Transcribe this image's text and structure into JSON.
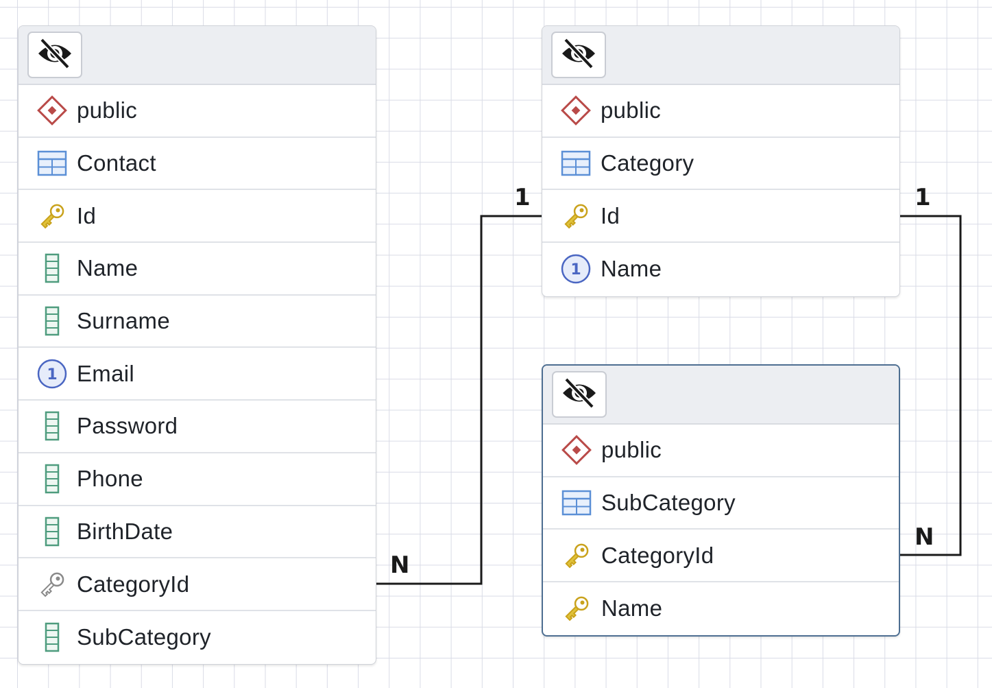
{
  "tables": [
    {
      "id": "contact",
      "rows": [
        {
          "icon": "schema-icon",
          "label": "public"
        },
        {
          "icon": "table-icon",
          "label": "Contact"
        },
        {
          "icon": "primary-key-icon",
          "label": "Id"
        },
        {
          "icon": "column-icon",
          "label": "Name"
        },
        {
          "icon": "column-icon",
          "label": "Surname"
        },
        {
          "icon": "unique-icon",
          "label": "Email"
        },
        {
          "icon": "column-icon",
          "label": "Password"
        },
        {
          "icon": "column-icon",
          "label": "Phone"
        },
        {
          "icon": "column-icon",
          "label": "BirthDate"
        },
        {
          "icon": "foreign-key-icon",
          "label": "CategoryId"
        },
        {
          "icon": "column-icon",
          "label": "SubCategory"
        }
      ]
    },
    {
      "id": "category",
      "rows": [
        {
          "icon": "schema-icon",
          "label": "public"
        },
        {
          "icon": "table-icon",
          "label": "Category"
        },
        {
          "icon": "primary-key-icon",
          "label": "Id"
        },
        {
          "icon": "unique-icon",
          "label": "Name"
        }
      ]
    },
    {
      "id": "subcategory",
      "rows": [
        {
          "icon": "schema-icon",
          "label": "public"
        },
        {
          "icon": "table-icon",
          "label": "SubCategory"
        },
        {
          "icon": "primary-key-icon",
          "label": "CategoryId"
        },
        {
          "icon": "primary-key-icon",
          "label": "Name"
        }
      ]
    }
  ],
  "relations": [
    {
      "from": "Contact.CategoryId",
      "to": "Category.Id",
      "from_card": "N",
      "to_card": "1"
    },
    {
      "from": "SubCategory.CategoryId",
      "to": "Category.Id",
      "from_card": "N",
      "to_card": "1"
    }
  ],
  "colors": {
    "schema": "#b94a48",
    "table": "#5b8fd6",
    "primary_key": "#e0c23a",
    "foreign_key": "#8a8a8a",
    "column": "#4e9c7e",
    "unique": "#4a66c2",
    "selected_border": "#4d6e91"
  }
}
